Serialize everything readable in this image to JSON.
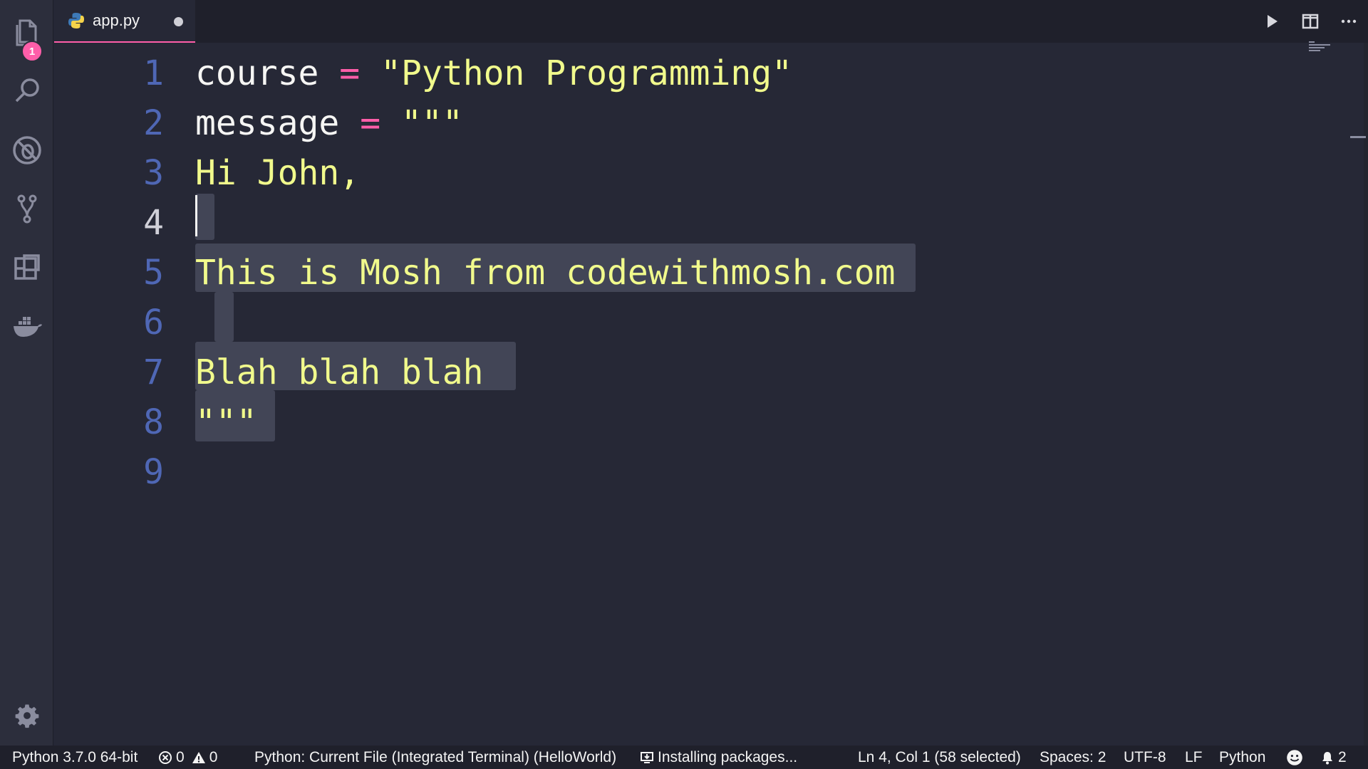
{
  "activity_bar": {
    "explorer_badge": "1",
    "icons": [
      "files-icon",
      "search-icon",
      "debug-icon",
      "source-control-icon",
      "extensions-icon",
      "docker-icon",
      "gear-icon"
    ]
  },
  "tab": {
    "filename": "app.py",
    "icon": "python-icon",
    "dirty": true
  },
  "tab_actions": [
    "run-icon",
    "split-editor-icon",
    "more-icon"
  ],
  "editor": {
    "lines": [
      {
        "number": "1",
        "tokens": [
          "course",
          " ",
          "=",
          " ",
          "\"Python Programming\""
        ]
      },
      {
        "number": "2",
        "tokens": [
          "message",
          " ",
          "=",
          " ",
          "\"\"\""
        ]
      },
      {
        "number": "3",
        "text": "Hi John,"
      },
      {
        "number": "4",
        "text": ""
      },
      {
        "number": "5",
        "text": "This is Mosh from codewithmosh.com"
      },
      {
        "number": "6",
        "text": ""
      },
      {
        "number": "7",
        "text": "Blah blah blah"
      },
      {
        "number": "8",
        "text": "\"\"\""
      },
      {
        "number": "9",
        "text": ""
      }
    ],
    "active_line": 4
  },
  "status_bar": {
    "interpreter": "Python 3.7.0 64-bit",
    "errors": "0",
    "warnings": "0",
    "run_config": "Python: Current File (Integrated Terminal) (HelloWorld)",
    "task": "Installing packages...",
    "cursor_position": "Ln 4, Col 1 (58 selected)",
    "indentation": "Spaces: 2",
    "encoding": "UTF-8",
    "eol": "LF",
    "language": "Python",
    "notifications": "2"
  },
  "colors": {
    "accent": "#ff5ea9",
    "string": "#f1fa8c",
    "line_number": "#4f67b5",
    "selection": "#424556",
    "background": "#262836"
  }
}
